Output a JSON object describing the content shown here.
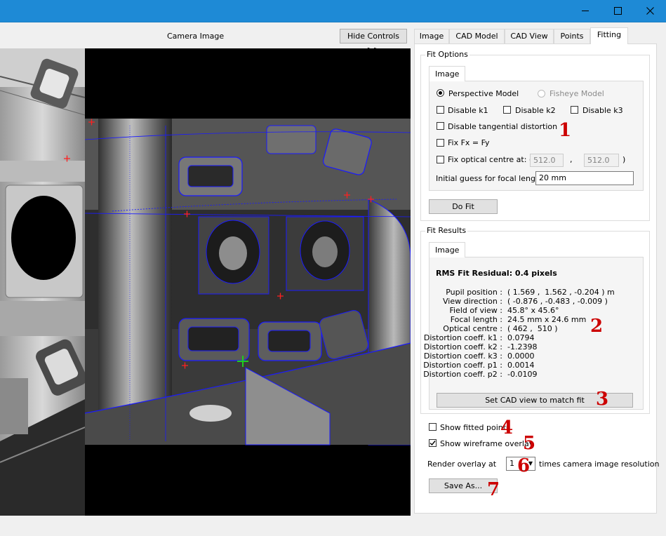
{
  "window": {
    "controls": [
      "minimize-icon",
      "maximize-icon",
      "close-icon"
    ]
  },
  "left": {
    "title": "Camera Image",
    "hide_controls": "Hide Controls >>"
  },
  "tabs": [
    {
      "label": "Image"
    },
    {
      "label": "CAD Model"
    },
    {
      "label": "CAD View"
    },
    {
      "label": "Points"
    },
    {
      "label": "Fitting"
    }
  ],
  "fit_options": {
    "group_title": "Fit Options",
    "subtab": "Image",
    "perspective_model": "Perspective Model",
    "fisheye_model": "Fisheye Model",
    "disable_k1": "Disable k1",
    "disable_k2": "Disable k2",
    "disable_k3": "Disable k3",
    "disable_tangential": "Disable tangential distortion",
    "fix_fx_fy": "Fix Fx = Fy",
    "fix_optical_centre": "Fix optical centre at: (",
    "centre_x": "512.0",
    "comma": ",",
    "centre_y": "512.0",
    "close_paren": ")",
    "focal_guess_label": "Initial guess for focal length:",
    "focal_guess_value": "20 mm",
    "do_fit": "Do Fit"
  },
  "fit_results": {
    "group_title": "Fit Results",
    "subtab": "Image",
    "rms": "RMS Fit Residual: 0.4 pixels",
    "rows": [
      {
        "label": "Pupil position :",
        "value": "( 1.569 ,  1.562 , -0.204 ) m"
      },
      {
        "label": "View direction :",
        "value": "( -0.876 , -0.483 , -0.009 )"
      },
      {
        "label": "Field of view :",
        "value": "45.8° x 45.6°"
      },
      {
        "label": "Focal length :",
        "value": "24.5 mm x 24.6 mm"
      },
      {
        "label": "Optical centre :",
        "value": "( 462 ,  510 )"
      },
      {
        "label": "Distortion coeff. k1 :",
        "value": "0.0794"
      },
      {
        "label": "Distortion coeff. k2 :",
        "value": "-1.2398"
      },
      {
        "label": "Distortion coeff. k3 :",
        "value": "0.0000"
      },
      {
        "label": "Distortion coeff. p1 :",
        "value": "0.0014"
      },
      {
        "label": "Distortion coeff. p2 :",
        "value": "-0.0109"
      }
    ],
    "set_cad_view": "Set CAD view to match fit"
  },
  "bottom": {
    "show_fitted_points": "Show fitted points",
    "show_wireframe": "Show wireframe overlay",
    "render_label": "Render overlay at",
    "render_value": "1",
    "render_suffix": "times camera image resolution",
    "save_as": "Save As..."
  },
  "annotations": [
    "1",
    "2",
    "3",
    "4",
    "5",
    "6",
    "7"
  ],
  "colors": {
    "titlebar": "#1e8ad6",
    "annotation": "#cc0000",
    "wireframe": "#1a1aff",
    "fit_point": "#ff2020",
    "selected_point": "#20cc20"
  }
}
